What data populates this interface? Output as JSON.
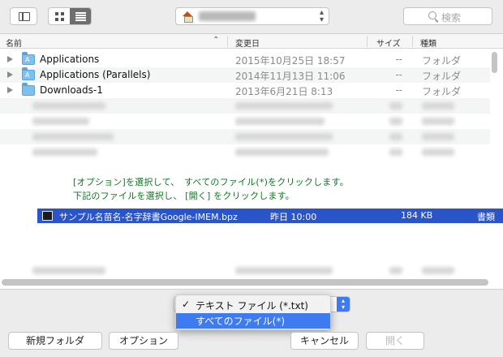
{
  "toolbar": {
    "search_placeholder": "検索"
  },
  "columns": {
    "name": "名前",
    "date": "変更日",
    "size": "サイズ",
    "kind": "種類"
  },
  "rows": [
    {
      "name": "Applications",
      "date": "2015年10月25日 18:57",
      "size": "--",
      "kind": "フォルダ"
    },
    {
      "name": "Applications (Parallels)",
      "date": "2014年11月13日 11:06",
      "size": "--",
      "kind": "フォルダ"
    },
    {
      "name": "Downloads-1",
      "date": "2013年6月21日 8:13",
      "size": "--",
      "kind": "フォルダ"
    }
  ],
  "instructions": {
    "line1": "[オプション]を選択して、　すべてのファイル(*)をクリックします。",
    "line2": "下記のファイルを選択し、 [開く] をクリックします。"
  },
  "selected_file": {
    "name": "サンプル名苗名-名字辞書Google-IMEM.bpz",
    "date": "昨日 10:00",
    "size": "184 KB",
    "kind": "書類"
  },
  "filter_menu": {
    "items": [
      "テキスト ファイル (*.txt)",
      "すべてのファイル(*)"
    ],
    "checked": "✓"
  },
  "buttons": {
    "new_folder": "新規フォルダ",
    "options": "オプション",
    "cancel": "キャンセル",
    "open": "開く"
  },
  "colors": {
    "selection": "#2a55c8",
    "menu_highlight": "#3e7bf0",
    "instruction_text": "#0c7a1e"
  }
}
